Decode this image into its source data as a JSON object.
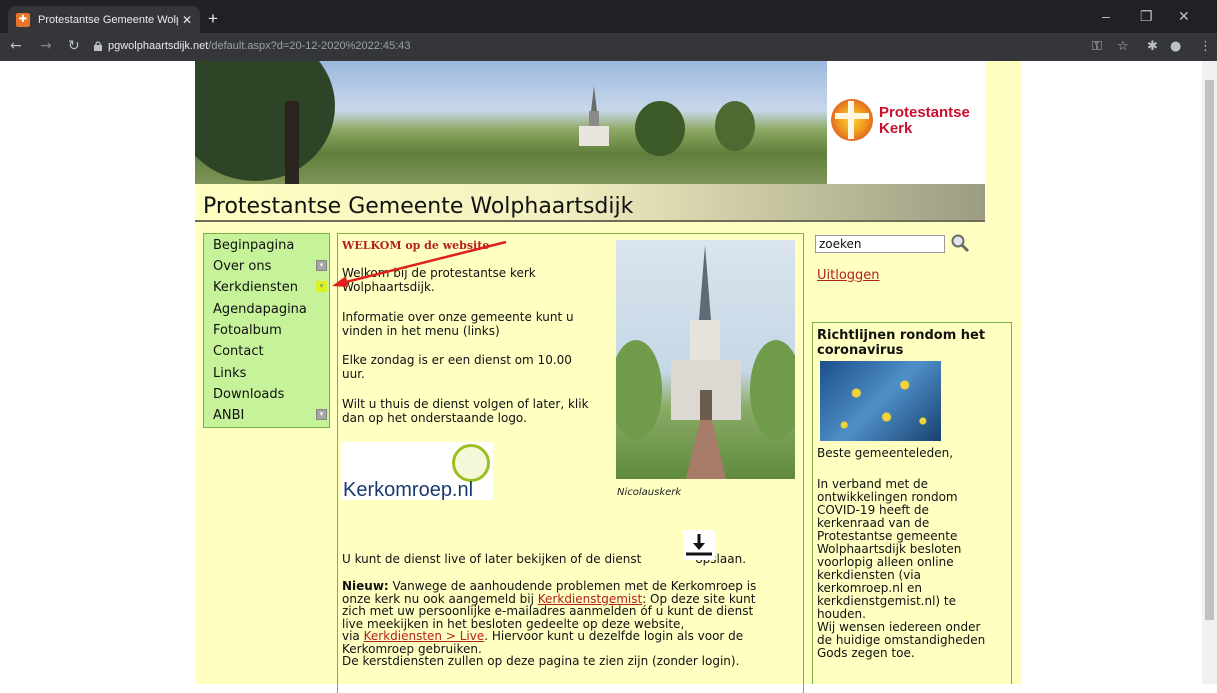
{
  "browser": {
    "tab_title": "Protestantse Gemeente Wolphaa",
    "url_host": "pgwolphaartsdijk.net",
    "url_path": "/default.aspx?d=20-12-2020%2022:45:43"
  },
  "header": {
    "logo_line1": "Protestantse",
    "logo_line2": "Kerk",
    "site_title": "Protestantse Gemeente Wolphaartsdijk"
  },
  "menu": {
    "items": [
      "Beginpagina",
      "Over ons",
      "Kerkdiensten",
      "Agendapagina",
      "Fotoalbum",
      "Contact",
      "Links",
      "Downloads",
      "ANBI"
    ]
  },
  "content": {
    "welkom": "WELKOM op de website",
    "p1_l1": "Welkom bij de protestantse kerk",
    "p1_l2": "Wolphaartsdijk.",
    "p2_l1": "Informatie over onze gemeente kunt u",
    "p2_l2": "vinden in het menu (links)",
    "p3_l1": "Elke zondag is er een dienst om 10.00",
    "p3_l2": "uur.",
    "p4_l1": "Wilt u thuis de dienst volgen of later, klik",
    "p4_l2": "dan op het onderstaande logo.",
    "kerkomroep": "Kerkomroep.nl",
    "photo_caption": "Nicolauskerk",
    "live_a": "U kunt de dienst live of later bekijken of de dienst",
    "live_b": "opslaan.",
    "nieuw_bold": "Nieuw:",
    "nieuw_l1": " Vanwege de aanhoudende problemen met de Kerkomroep is",
    "nieuw_l2a": "onze kerk nu ook aangemeld bij ",
    "nieuw_link1": "Kerkdienstgemist",
    "nieuw_l2b": ": Op deze site kunt",
    "nieuw_l3": "zich met uw persoonlijke e-mailadres aanmelden óf u kunt de dienst",
    "nieuw_l4": "live meekijken in het besloten gedeelte op deze website,",
    "nieuw_l5a": "via ",
    "nieuw_link2": "Kerkdiensten > Live",
    "nieuw_l5b": ". Hiervoor kunt u dezelfde login als voor de",
    "nieuw_l6": "Kerkomroep gebruiken.",
    "nieuw_l7": "De kerstdiensten zullen op deze pagina te zien zijn (zonder login)."
  },
  "sidebar": {
    "search_value": "zoeken",
    "logout": "Uitloggen",
    "box_title_l1": "Richtlijnen rondom het",
    "box_title_l2": "coronavirus",
    "greeting": "Beste gemeenteleden,",
    "lines": [
      "In verband met de",
      "ontwikkelingen rondom",
      "COVID-19 heeft de",
      "kerkenraad van de",
      "Protestantse gemeente",
      "Wolphaartsdijk besloten",
      "voorlopig alleen online",
      "kerkdiensten (via",
      "kerkomroep.nl en",
      "kerkdienstgemist.nl) te",
      "houden.",
      "Wij wensen iedereen onder",
      "de huidige omstandigheden",
      "Gods zegen toe."
    ]
  },
  "colors": {
    "page_bg": "#ffffc2",
    "menu_bg": "#c6f29a",
    "link": "#b22222",
    "annotation_arrow": "#e0201b"
  }
}
